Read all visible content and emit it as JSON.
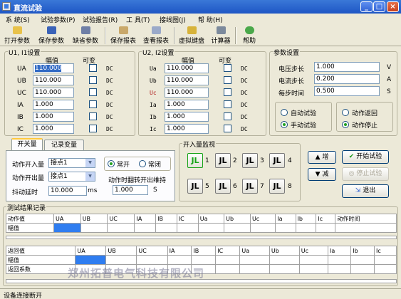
{
  "window": {
    "title": "直流试验",
    "minimize": "_",
    "maximize": "□",
    "close": "×"
  },
  "menu": [
    "系 统(S)",
    "试验参数(P)",
    "试验报告(R)",
    "工 具(T)",
    "接线图(J)",
    "帮 助(H)"
  ],
  "toolbar": [
    "打开参数",
    "保存参数",
    "缺省参数",
    "保存报表",
    "查看报表",
    "虚拟键盘",
    "计算器",
    "帮助"
  ],
  "group1": {
    "title": "U1, I1设置",
    "col_value": "幅值",
    "col_var": "可变",
    "rows": [
      {
        "label": "UA",
        "value": "110.000",
        "dc": "DC"
      },
      {
        "label": "UB",
        "value": "110.000",
        "dc": "DC"
      },
      {
        "label": "UC",
        "value": "110.000",
        "dc": "DC"
      },
      {
        "label": "IA",
        "value": "1.000",
        "dc": "DC"
      },
      {
        "label": "IB",
        "value": "1.000",
        "dc": "DC"
      },
      {
        "label": "IC",
        "value": "1.000",
        "dc": "DC"
      }
    ]
  },
  "group2": {
    "title": "U2, I2设置",
    "col_value": "幅值",
    "col_var": "可变",
    "rows": [
      {
        "label": "Ua",
        "value": "110.000",
        "dc": "DC"
      },
      {
        "label": "Ub",
        "value": "110.000",
        "dc": "DC"
      },
      {
        "label": "Uc",
        "value": "110.000",
        "dc": "DC"
      },
      {
        "label": "Ia",
        "value": "1.000",
        "dc": "DC"
      },
      {
        "label": "Ib",
        "value": "1.000",
        "dc": "DC"
      },
      {
        "label": "Ic",
        "value": "1.000",
        "dc": "DC"
      }
    ]
  },
  "params": {
    "title": "参数设置",
    "rows": [
      {
        "label": "电压步长",
        "value": "1.000",
        "unit": "V"
      },
      {
        "label": "电流步长",
        "value": "0.200",
        "unit": "A"
      },
      {
        "label": "每步时间",
        "value": "0.500",
        "unit": "S"
      }
    ],
    "mode": {
      "auto": "自动试验",
      "manual": "手动试验",
      "selected": "manual"
    },
    "action": {
      "return": "动作返回",
      "stop": "动作停止",
      "selected": "stop"
    }
  },
  "tabs": {
    "switch": "开关量",
    "record": "记录变量",
    "active": "switch"
  },
  "switch_panel": {
    "in_label": "动作开入量",
    "in_value": "接点1",
    "out_label": "动作开出量",
    "out_value": "接点1",
    "jitter_label": "抖动延时",
    "jitter_value": "10.000",
    "jitter_unit": "ms",
    "normally_open": "常开",
    "normally_closed": "常闭",
    "contact_selected": "open",
    "flip_label": "动作时翻转开出维持",
    "flip_value": "1.000",
    "flip_unit": "S"
  },
  "monitor": {
    "title": "开入量监视",
    "numbers": [
      "1",
      "2",
      "3",
      "4",
      "5",
      "6",
      "7",
      "8"
    ],
    "active": 1
  },
  "side_buttons": {
    "up": "增",
    "down": "减",
    "start": "开始试验",
    "stop": "停止试验",
    "exit": "退出"
  },
  "results": {
    "title": "测试结果记录",
    "table1_headers": [
      "动作值",
      "UA",
      "UB",
      "UC",
      "IA",
      "IB",
      "IC",
      "Ua",
      "Ub",
      "Uc",
      "Ia",
      "Ib",
      "Ic",
      "动作时间"
    ],
    "table1_rows": [
      "幅值"
    ],
    "table2_headers": [
      "返回值",
      "UA",
      "UB",
      "UC",
      "IA",
      "IB",
      "IC",
      "Ua",
      "Ub",
      "Uc",
      "Ia",
      "Ib",
      "Ic"
    ],
    "table2_rows": [
      "幅值",
      "返回系数"
    ]
  },
  "watermark": "郑州拓普电气科技有限公司",
  "status": "设备连接断开"
}
